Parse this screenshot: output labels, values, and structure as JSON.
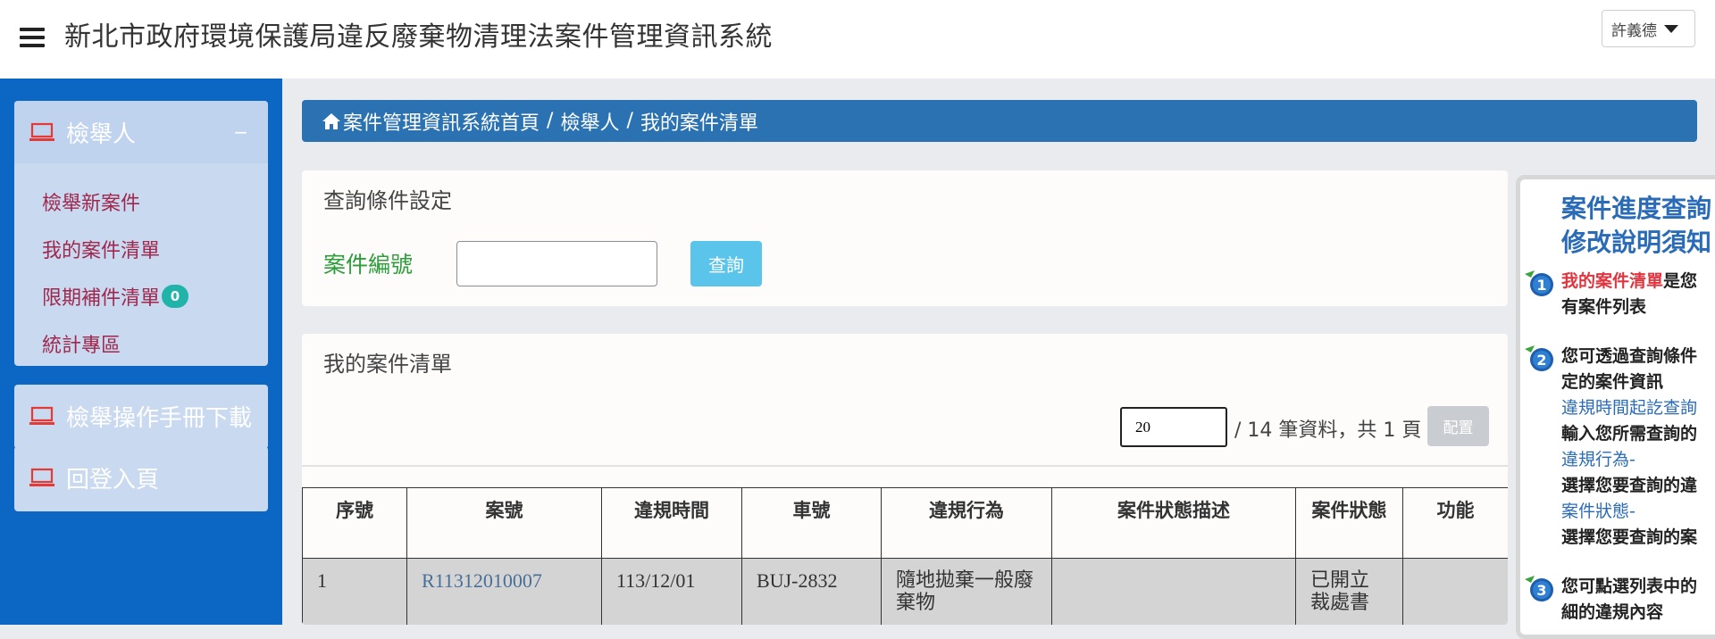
{
  "header": {
    "title": "新北市政府環境保護局違反廢棄物清理法案件管理資訊系統",
    "user_name": "許義德"
  },
  "sidebar": {
    "panels": [
      {
        "title": "檢舉人",
        "collapse_symbol": "−",
        "items": [
          {
            "label": "檢舉新案件"
          },
          {
            "label": "我的案件清單"
          },
          {
            "label": "限期補件清單",
            "badge": "0"
          },
          {
            "label": "統計專區"
          }
        ]
      },
      {
        "title": "檢舉操作手冊下載"
      },
      {
        "title": "回登入頁"
      }
    ]
  },
  "breadcrumb": {
    "items": [
      "案件管理資訊系統首頁",
      "檢舉人",
      "我的案件清單"
    ],
    "separator": "/"
  },
  "query": {
    "title": "查詢條件設定",
    "case_number_label": "案件編號",
    "case_number_value": "",
    "button_label": "查詢"
  },
  "case_list": {
    "title": "我的案件清單",
    "page_size": "20",
    "summary": "/ 14 筆資料，共 1 頁",
    "config_label": "配置",
    "columns": [
      "序號",
      "案號",
      "違規時間",
      "車號",
      "違規行為",
      "案件狀態描述",
      "案件狀態",
      "功能"
    ],
    "rows": [
      {
        "index": "1",
        "case_no": "R11312010007",
        "time": "113/12/01",
        "plate": "BUJ-2832",
        "behavior": "隨地拋棄一般廢棄物",
        "description": "",
        "status": "已開立裁處書",
        "function": ""
      }
    ]
  },
  "help": {
    "title_line1": "案件進度查詢",
    "title_line2": "修改說明須知",
    "steps": [
      {
        "number": "1",
        "lines": [
          {
            "text": "我的案件清單",
            "style": "red",
            "rest": "是您"
          },
          {
            "text": "有案件列表"
          }
        ]
      },
      {
        "number": "2",
        "lines": [
          {
            "text": "您可透過查詢條件"
          },
          {
            "text": "定的案件資訊"
          },
          {
            "text": "違規時間起訖查詢",
            "style": "blue-sub"
          },
          {
            "text": "輸入您所需查詢的"
          },
          {
            "text": "違規行為-",
            "style": "blue-sub"
          },
          {
            "text": "選擇您要查詢的違"
          },
          {
            "text": "案件狀態-",
            "style": "blue-sub"
          },
          {
            "text": "選擇您要查詢的案"
          }
        ]
      },
      {
        "number": "3",
        "lines": [
          {
            "text": "您可點選列表中的"
          },
          {
            "text": "細的違規內容"
          }
        ]
      }
    ]
  },
  "colors": {
    "sidebar": "#0c67c4",
    "breadcrumb": "#2b72b2",
    "link": "#a0284e",
    "label_green": "#2c9e3a",
    "query_button": "#5bc4ea",
    "badge": "#1fb3a9"
  },
  "icons": [
    "hamburger-icon",
    "laptop-icon",
    "home-icon",
    "caret-down-icon",
    "step-number-icon"
  ]
}
